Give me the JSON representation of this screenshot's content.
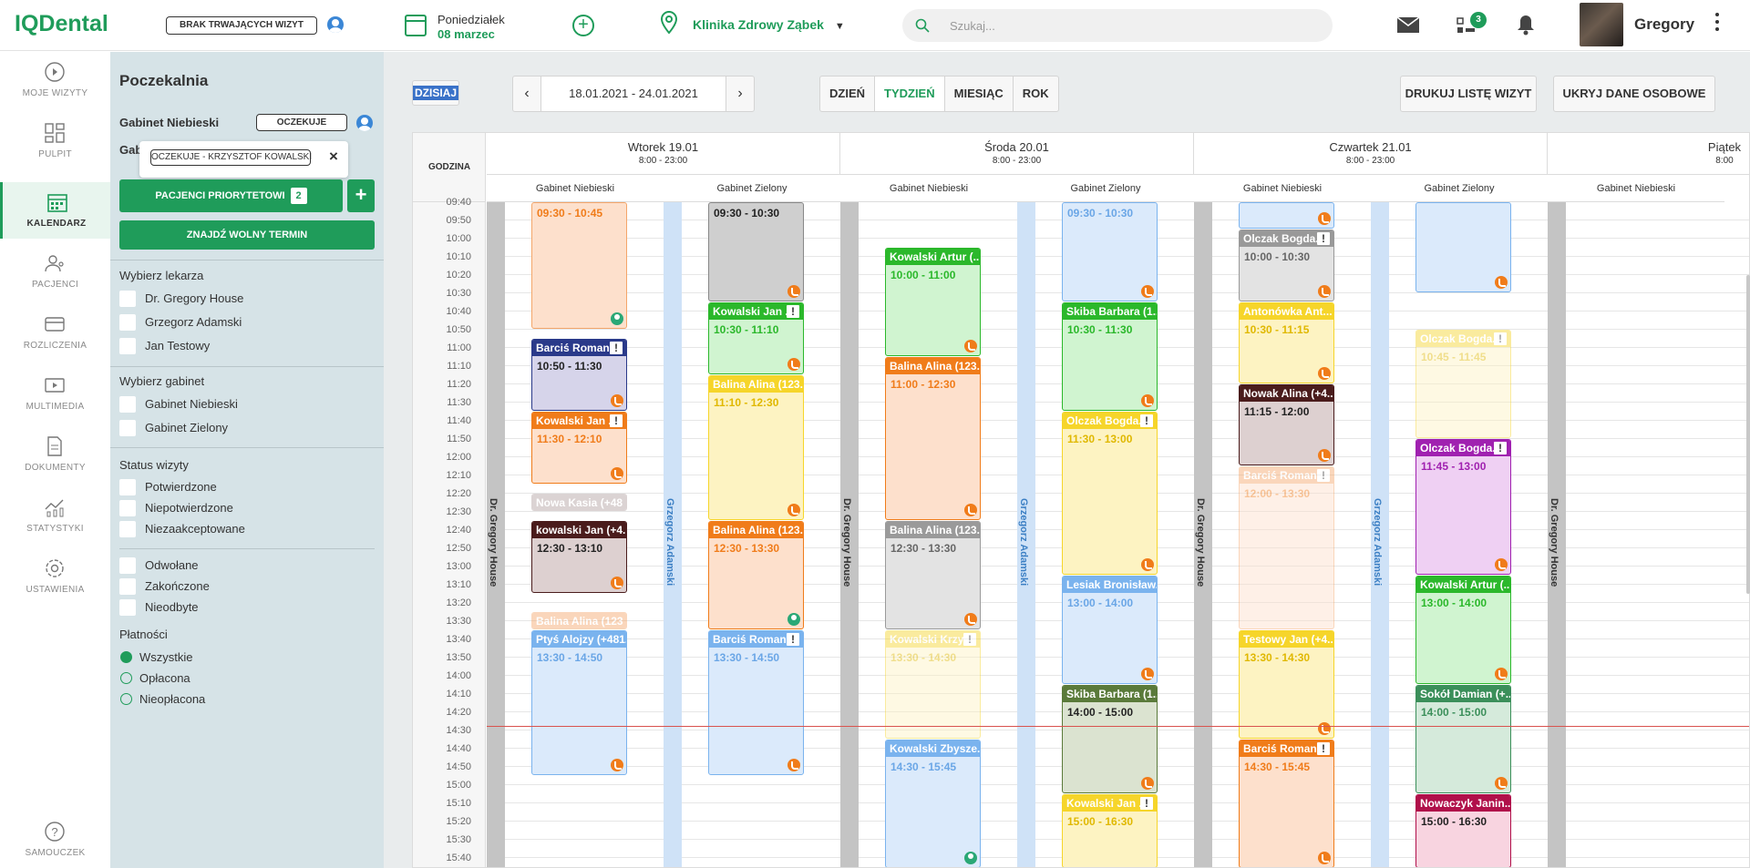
{
  "top": {
    "logo": "IQDental",
    "no_visits": "BRAK TRWAJĄCYCH WIZYT",
    "day_name": "Poniedziałek",
    "date": "08 marzec",
    "clinic": "Klinika Zdrowy Ząbek",
    "search_placeholder": "Szukaj...",
    "tasks_badge": "3",
    "user": "Gregory"
  },
  "nav": [
    {
      "label": "MOJE WIZYTY"
    },
    {
      "label": "PULPIT"
    },
    {
      "label": "KALENDARZ"
    },
    {
      "label": "PACJENCI"
    },
    {
      "label": "ROZLICZENIA"
    },
    {
      "label": "MULTIMEDIA"
    },
    {
      "label": "DOKUMENTY"
    },
    {
      "label": "STATYSTYKI"
    },
    {
      "label": "USTAWIENIA"
    },
    {
      "label": "SAMOUCZEK"
    }
  ],
  "waiting": {
    "title": "Poczekalnia",
    "room1": "Gabinet Niebieski",
    "room1_status": "OCZEKUJE",
    "room2_partial": "Gab",
    "popup_label": "OCZEKUJE - KRZYSZTOF KOWALSKI",
    "popup_close": "×",
    "priority_btn": "PACJENCI PRIORYTETOWI",
    "priority_count": "2",
    "plus": "+",
    "find_btn": "ZNAJDŹ WOLNY TERMIN",
    "doctors_title": "Wybierz lekarza",
    "doctors": [
      "Dr. Gregory House",
      "Grzegorz Adamski",
      "Jan Testowy"
    ],
    "rooms_title": "Wybierz gabinet",
    "rooms": [
      "Gabinet Niebieski",
      "Gabinet Zielony"
    ],
    "status_title": "Status wizyty",
    "statuses": [
      "Potwierdzone",
      "Niepotwierdzone",
      "Niezaakceptowane"
    ],
    "statuses2": [
      "Odwołane",
      "Zakończone",
      "Nieodbyte"
    ],
    "payments_title": "Płatności",
    "payments": [
      "Wszystkie",
      "Opłacona",
      "Nieopłacona"
    ]
  },
  "toolbar": {
    "today": "DZISIAJ",
    "range": "18.01.2021 - 24.01.2021",
    "views": [
      "DZIEŃ",
      "TYDZIEŃ",
      "MIESIĄC",
      "ROK"
    ],
    "print": "DRUKUJ LISTĘ WIZYT",
    "hide": "UKRYJ DANE OSOBOWE"
  },
  "calendar": {
    "hour_header": "GODZINA",
    "hours": [
      "09:40",
      "09:50",
      "10:00",
      "10:10",
      "10:20",
      "10:30",
      "10:40",
      "10:50",
      "11:00",
      "11:10",
      "11:20",
      "11:30",
      "11:40",
      "11:50",
      "12:00",
      "12:10",
      "12:20",
      "12:30",
      "12:40",
      "12:50",
      "13:00",
      "13:10",
      "13:20",
      "13:30",
      "13:40",
      "13:50",
      "14:00",
      "14:10",
      "14:20",
      "14:30",
      "14:40",
      "14:50",
      "15:00",
      "15:10",
      "15:20",
      "15:30",
      "15:40"
    ],
    "days": [
      {
        "name": "Wtorek 19.01",
        "hours": "8:00 - 23:00"
      },
      {
        "name": "Środa 20.01",
        "hours": "8:00 - 23:00"
      },
      {
        "name": "Czwartek 21.01",
        "hours": "8:00 - 23:00"
      },
      {
        "name": "Piątek",
        "hours": "8:00"
      }
    ],
    "room_niebieski": "Gabinet Niebieski",
    "room_zielony": "Gabinet Zielony",
    "doc_house": "Dr. Gregory House",
    "doc_adamski": "Grzegorz Adamski",
    "appointments": [
      {
        "title": "",
        "time": "09:30 - 10:45"
      },
      {
        "title": "Barciś Roman...",
        "time": "10:50 - 11:30"
      },
      {
        "title": "Kowalski Jan ...",
        "time": "11:30 - 12:10"
      },
      {
        "title": "Nowa Kasia (+48",
        "time": ""
      },
      {
        "title": "kowalski Jan (+4...",
        "time": "12:30 - 13:10"
      },
      {
        "title": "Balina Alina (123",
        "time": ""
      },
      {
        "title": "Ptyś Alojzy (+481...",
        "time": "13:30 - 14:50"
      },
      {
        "title": "",
        "time": "09:30 - 10:30"
      },
      {
        "title": "Kowalski Jan ...",
        "time": "10:30 - 11:10"
      },
      {
        "title": "Balina Alina (123...",
        "time": "11:10 - 12:30"
      },
      {
        "title": "Balina Alina (123...",
        "time": "12:30 - 13:30"
      },
      {
        "title": "Barciś Roman...",
        "time": "13:30 - 14:50"
      },
      {
        "title": "Kowalski Artur (...",
        "time": "10:00 - 11:00"
      },
      {
        "title": "Balina Alina (123...",
        "time": "11:00 - 12:30"
      },
      {
        "title": "Balina Alina (123...",
        "time": "12:30 - 13:30"
      },
      {
        "title": "Kowalski Krzy...",
        "time": "13:30 - 14:30"
      },
      {
        "title": "Kowalski Zbysze...",
        "time": "14:30 - 15:45"
      },
      {
        "title": "",
        "time": "09:30 - 10:30"
      },
      {
        "title": "Skiba Barbara (1...",
        "time": "10:30 - 11:30"
      },
      {
        "title": "Olczak Bogda...",
        "time": "11:30 - 13:00"
      },
      {
        "title": "Lesiak Bronisław...",
        "time": "13:00 - 14:00"
      },
      {
        "title": "Skiba Barbara (1...",
        "time": "14:00 - 15:00"
      },
      {
        "title": "Kowalski Jan ...",
        "time": "15:00 - 16:30"
      },
      {
        "title": "",
        "time": ""
      },
      {
        "title": "Olczak Bogda...",
        "time": "10:00 - 10:30"
      },
      {
        "title": "Antonówka Ant...",
        "time": "10:30 - 11:15"
      },
      {
        "title": "Nowak Alina (+4...",
        "time": "11:15 - 12:00"
      },
      {
        "title": "Barciś Roman...",
        "time": "12:00 - 13:30"
      },
      {
        "title": "Testowy Jan (+4...",
        "time": "13:30 - 14:30"
      },
      {
        "title": "Barciś Roman...",
        "time": "14:30 - 15:45"
      },
      {
        "title": "",
        "time": ""
      },
      {
        "title": "Olczak Bogda...",
        "time": "10:45 - 11:45"
      },
      {
        "title": "Olczak Bogda...",
        "time": "11:45 - 13:00"
      },
      {
        "title": "Kowalski Artur (...",
        "time": "13:00 - 14:00"
      },
      {
        "title": "Sokół Damian (+...",
        "time": "14:00 - 15:00"
      },
      {
        "title": "Nowaczyk Janin...",
        "time": "15:00 - 16:30"
      }
    ]
  }
}
